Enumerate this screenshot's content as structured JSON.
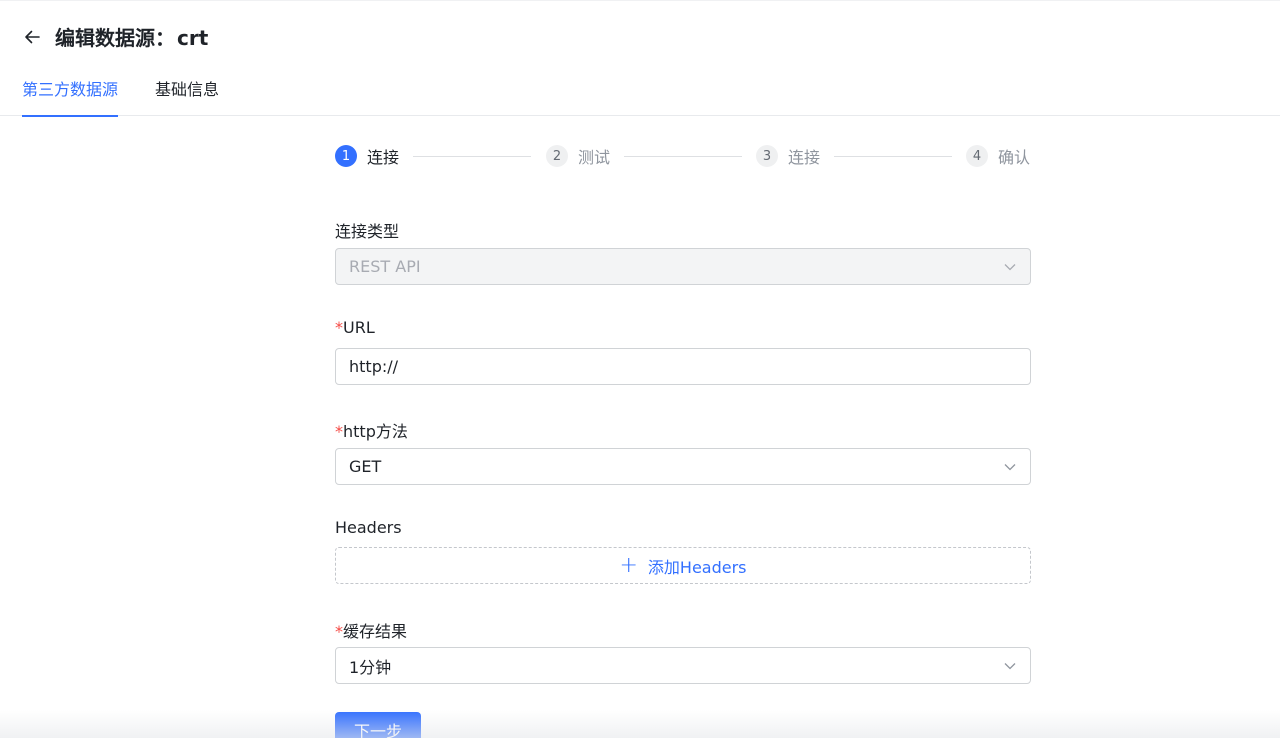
{
  "header": {
    "back_icon": "arrow-left-icon",
    "title_prefix": "编辑数据源：",
    "title_name": "crt"
  },
  "tabs": [
    {
      "label": "第三方数据源",
      "active": true
    },
    {
      "label": "基础信息",
      "active": false
    }
  ],
  "steps": [
    {
      "num": "1",
      "label": "连接",
      "active": true
    },
    {
      "num": "2",
      "label": "测试",
      "active": false
    },
    {
      "num": "3",
      "label": "连接",
      "active": false
    },
    {
      "num": "4",
      "label": "确认",
      "active": false
    }
  ],
  "form": {
    "connection_type": {
      "label": "连接类型",
      "value": "REST API",
      "disabled": true
    },
    "url": {
      "required_mark": "*",
      "label": "URL",
      "value": "http://"
    },
    "http_method": {
      "required_mark": "*",
      "label": "http方法",
      "value": "GET"
    },
    "headers": {
      "label": "Headers",
      "add_label": "添加Headers"
    },
    "cache": {
      "required_mark": "*",
      "label": "缓存结果",
      "value": "1分钟"
    },
    "next_button": "下一步"
  },
  "colors": {
    "accent": "#3370ff",
    "required": "#f54a45"
  }
}
